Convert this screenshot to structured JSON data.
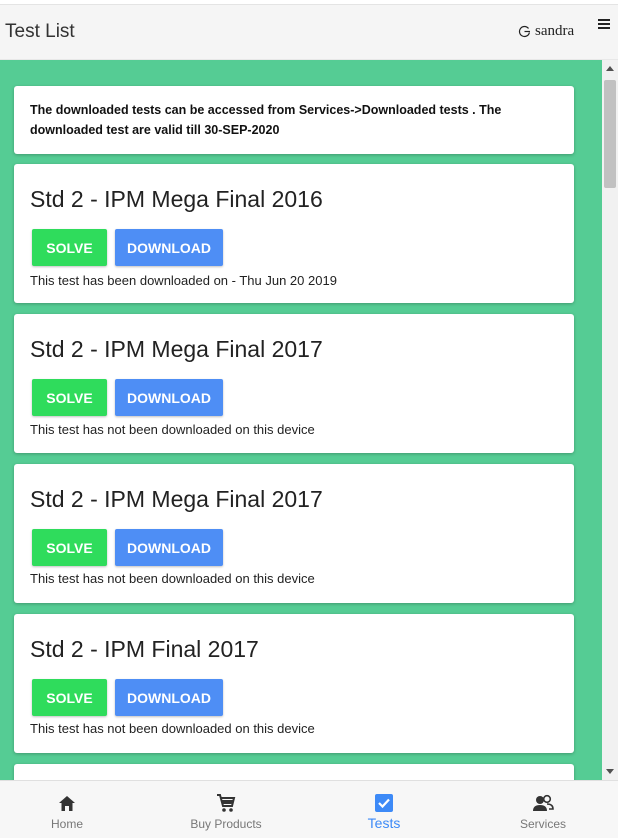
{
  "header": {
    "title": "Test List",
    "user_name": "sandra"
  },
  "notice": {
    "text": "The downloaded tests can be accessed from Services->Downloaded tests . The downloaded test are valid till 30-SEP-2020"
  },
  "tests": [
    {
      "title": "Std 2 - IPM Mega Final 2016",
      "solve_label": "SOLVE",
      "download_label": "DOWNLOAD",
      "status": "This test has been downloaded on - Thu Jun 20 2019"
    },
    {
      "title": "Std 2 - IPM Mega Final 2017",
      "solve_label": "SOLVE",
      "download_label": "DOWNLOAD",
      "status": "This test has not been downloaded on this device"
    },
    {
      "title": "Std 2 - IPM Mega Final 2017",
      "solve_label": "SOLVE",
      "download_label": "DOWNLOAD",
      "status": "This test has not been downloaded on this device"
    },
    {
      "title": "Std 2 - IPM Final 2017",
      "solve_label": "SOLVE",
      "download_label": "DOWNLOAD",
      "status": "This test has not been downloaded on this device"
    }
  ],
  "bottom_nav": [
    {
      "label": "Home",
      "icon": "home-icon"
    },
    {
      "label": "Buy Products",
      "icon": "cart-icon"
    },
    {
      "label": "Tests",
      "icon": "checkbox-icon",
      "active": true
    },
    {
      "label": "Services",
      "icon": "users-icon"
    }
  ],
  "colors": {
    "content_bg": "#55cc94",
    "solve_button": "#2fdc5c",
    "download_button": "#4e8ef5",
    "active_nav": "#3d8af7"
  }
}
